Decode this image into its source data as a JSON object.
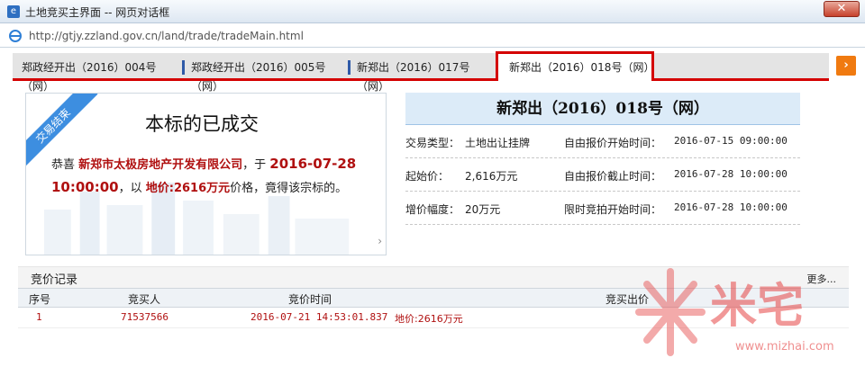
{
  "window": {
    "title": "土地竞买主界面 -- 网页对话框",
    "close_label": "✕",
    "url": "http://gtjy.zzland.gov.cn/land/trade/tradeMain.html"
  },
  "tabs": [
    {
      "label": "郑政经开出（2016）004号（网）"
    },
    {
      "label": "郑政经开出（2016）005号（网）"
    },
    {
      "label": "新郑出（2016）017号（网）"
    },
    {
      "label": "新郑出（2016）018号（网）"
    }
  ],
  "next_button": "›",
  "result": {
    "ribbon": "交易结束",
    "heading": "本标的已成交",
    "text_prefix": "恭喜 ",
    "company": "新郑市太极房地产开发有限公司",
    "text_mid1": "，于 ",
    "time": "2016-07-28 10:00:00",
    "text_mid2": "，以 ",
    "price": "地价:2616万元",
    "text_suffix": "价格，竟得该宗标的。",
    "more_arrow": "›"
  },
  "info": {
    "title": "新郑出（2016）018号（网）",
    "rows": [
      {
        "k1": "交易类型：",
        "v1": "土地出让挂牌",
        "k2": "自由报价开始时间：",
        "v2": "2016-07-15 09:00:00"
      },
      {
        "k1": "起始价：",
        "v1": "2,616万元",
        "k2": "自由报价截止时间：",
        "v2": "2016-07-28 10:00:00"
      },
      {
        "k1": "增价幅度：",
        "v1": "20万元",
        "k2": "限时竞拍开始时间：",
        "v2": "2016-07-28 10:00:00"
      }
    ]
  },
  "records": {
    "label": "竞价记录",
    "more": "更多...",
    "columns": [
      "序号",
      "竞买人",
      "竞价时间",
      "竞买出价"
    ],
    "rows": [
      {
        "no": "1",
        "bidder": "71537566",
        "time": "2016-07-21 14:53:01.837",
        "price": "地价:2616万元"
      }
    ]
  },
  "watermark": {
    "brand": "米宅",
    "site": "www.mizhai.com"
  },
  "colors": {
    "accent_red": "#d40000",
    "tab_separator": "#2f5aa8",
    "price_red": "#b01010",
    "ribbon_blue": "#3d8ee0",
    "next_orange": "#f07a10"
  }
}
